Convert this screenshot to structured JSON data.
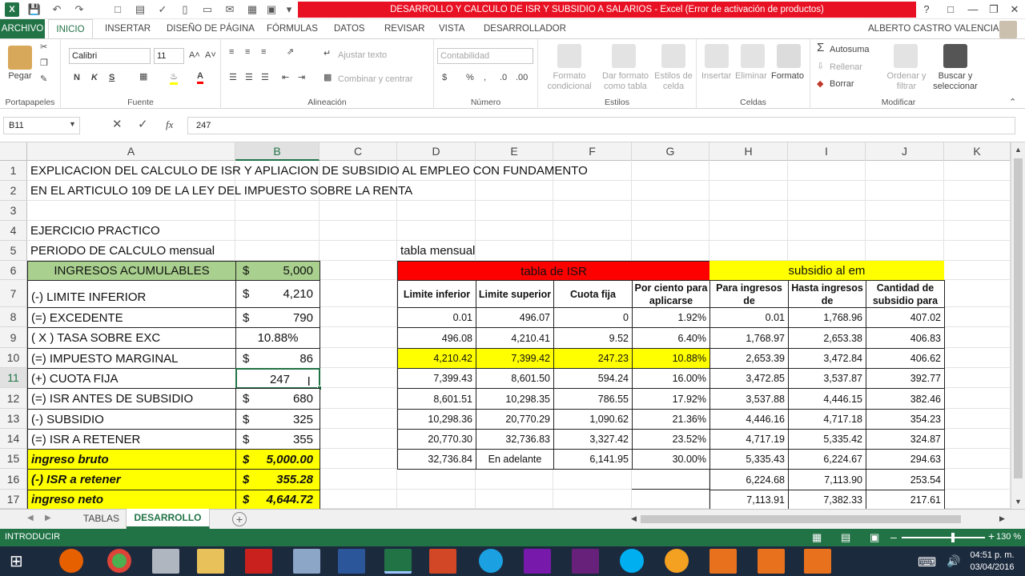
{
  "window": {
    "title": "DESARROLLO Y CALCULO DE ISR Y SUBSIDIO A SALARIOS -  Excel (Error de activación de productos)",
    "user": "ALBERTO CASTRO VALENCIA"
  },
  "tabs": [
    "ARCHIVO",
    "INICIO",
    "INSERTAR",
    "DISEÑO DE PÁGINA",
    "FÓRMULAS",
    "DATOS",
    "REVISAR",
    "VISTA",
    "DESARROLLADOR"
  ],
  "ribbon": {
    "clipboard": {
      "paste": "Pegar",
      "label": "Portapapeles"
    },
    "font": {
      "name": "Calibri",
      "size": "11",
      "bold": "N",
      "italic": "K",
      "underline": "S",
      "label": "Fuente"
    },
    "alignment": {
      "wrap": "Ajustar texto",
      "merge": "Combinar y centrar",
      "label": "Alineación"
    },
    "number": {
      "format": "Contabilidad",
      "label": "Número"
    },
    "styles": {
      "cond": "Formato condicional",
      "table": "Dar formato como tabla",
      "cellstyles": "Estilos de celda",
      "label": "Estilos"
    },
    "cells": {
      "insert": "Insertar",
      "delete": "Eliminar",
      "format": "Formato",
      "label": "Celdas"
    },
    "editing": {
      "autosum": "Autosuma",
      "fill": "Rellenar",
      "clear": "Borrar",
      "sort": "Ordenar y filtrar",
      "find": "Buscar y seleccionar",
      "label": "Modificar"
    }
  },
  "formula_bar": {
    "name_box": "B11",
    "formula": "247",
    "fx": "fx"
  },
  "columns": [
    "A",
    "B",
    "C",
    "D",
    "E",
    "F",
    "G",
    "H",
    "I",
    "J",
    "K"
  ],
  "rows": [
    "1",
    "2",
    "3",
    "4",
    "5",
    "6",
    "7",
    "8",
    "9",
    "10",
    "11",
    "12",
    "13",
    "14",
    "15",
    "16",
    "17"
  ],
  "text": {
    "r1": "EXPLICACION DEL CALCULO DE ISR Y APLIACION DE SUBSIDIO AL EMPLEO CON FUNDAMENTO",
    "r2": "EN EL ARTICULO 109 DE LA LEY DEL IMPUESTO SOBRE LA RENTA",
    "r4": "EJERCICIO PRACTICO",
    "r5": "PERIODO DE CALCULO mensual",
    "tabla_mensual": "tabla mensual"
  },
  "calc": [
    {
      "label": "INGRESOS ACUMULABLES",
      "cur": "$",
      "value": "5,000"
    },
    {
      "label": "(-) LIMITE INFERIOR",
      "cur": "$",
      "value": "4,210"
    },
    {
      "label": "(=) EXCEDENTE",
      "cur": "$",
      "value": "790"
    },
    {
      "label": "( X ) TASA SOBRE EXC",
      "cur": "",
      "value": "10.88%"
    },
    {
      "label": "(=) IMPUESTO MARGINAL",
      "cur": "$",
      "value": "86"
    },
    {
      "label": "(+) CUOTA FIJA",
      "cur": "",
      "value": "247"
    },
    {
      "label": "(=) ISR ANTES DE SUBSIDIO",
      "cur": "$",
      "value": "680"
    },
    {
      "label": "(-) SUBSIDIO",
      "cur": "$",
      "value": "325"
    },
    {
      "label": "(=) ISR A RETENER",
      "cur": "$",
      "value": "355"
    },
    {
      "label": "ingreso bruto",
      "cur": "$",
      "value": "5,000.00"
    },
    {
      "label": "(-) ISR a retener",
      "cur": "$",
      "value": "355.28"
    },
    {
      "label": "ingreso neto",
      "cur": "$",
      "value": "4,644.72"
    }
  ],
  "isr": {
    "title": "tabla de ISR",
    "headers": [
      "Limite inferior",
      "Limite superior",
      "Cuota fija",
      "Por ciento para aplicarse"
    ],
    "rows": [
      [
        "0.01",
        "496.07",
        "0",
        "1.92%"
      ],
      [
        "496.08",
        "4,210.41",
        "9.52",
        "6.40%"
      ],
      [
        "4,210.42",
        "7,399.42",
        "247.23",
        "10.88%"
      ],
      [
        "7,399.43",
        "8,601.50",
        "594.24",
        "16.00%"
      ],
      [
        "8,601.51",
        "10,298.35",
        "786.55",
        "17.92%"
      ],
      [
        "10,298.36",
        "20,770.29",
        "1,090.62",
        "21.36%"
      ],
      [
        "20,770.30",
        "32,736.83",
        "3,327.42",
        "23.52%"
      ],
      [
        "32,736.84",
        "En adelante",
        "6,141.95",
        "30.00%"
      ]
    ]
  },
  "subsidio": {
    "title": "subsidio al em",
    "headers": [
      "Para ingresos de",
      "Hasta ingresos de",
      "Cantidad de subsidio para"
    ],
    "rows": [
      [
        "0.01",
        "1,768.96",
        "407.02"
      ],
      [
        "1,768.97",
        "2,653.38",
        "406.83"
      ],
      [
        "2,653.39",
        "3,472.84",
        "406.62"
      ],
      [
        "3,472.85",
        "3,537.87",
        "392.77"
      ],
      [
        "3,537.88",
        "4,446.15",
        "382.46"
      ],
      [
        "4,446.16",
        "4,717.18",
        "354.23"
      ],
      [
        "4,717.19",
        "5,335.42",
        "324.87"
      ],
      [
        "5,335.43",
        "6,224.67",
        "294.63"
      ],
      [
        "6,224.68",
        "7,113.90",
        "253.54"
      ],
      [
        "7,113.91",
        "7,382.33",
        "217.61"
      ]
    ]
  },
  "sheets": [
    "TABLAS",
    "DESARROLLO"
  ],
  "status": {
    "mode": "INTRODUCIR",
    "zoom": "130 %"
  },
  "clock": {
    "time": "04:51 p. m.",
    "date": "03/04/2016"
  },
  "colors": {
    "excel_green": "#217346",
    "isr_header": "#ff0000",
    "subsidio_header": "#ffff00",
    "label_green": "#a9d08e",
    "highlight_yellow": "#ffff00"
  }
}
